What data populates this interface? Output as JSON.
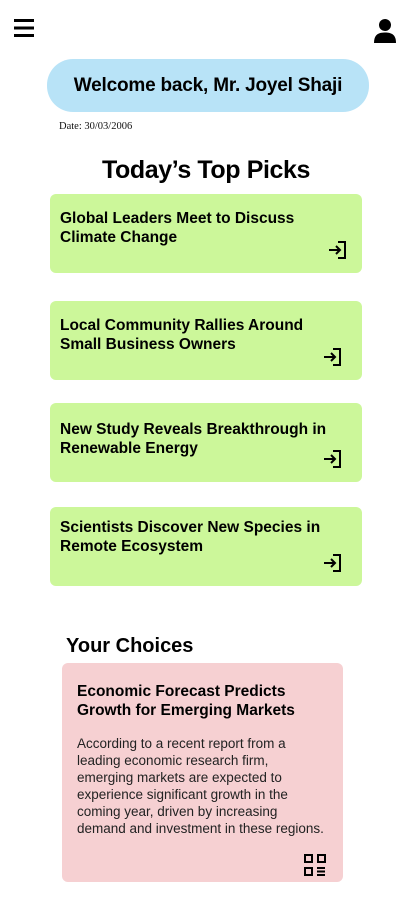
{
  "header": {
    "menu_icon": "hamburger-menu-icon",
    "profile_icon": "user-profile-icon",
    "welcome_text": "Welcome back, Mr. Joyel Shaji",
    "date_text": "Date: 30/03/2006"
  },
  "top_picks": {
    "title": "Today’s Top Picks",
    "items": [
      {
        "title": "Global Leaders Meet to Discuss Climate Change",
        "icon": "login-arrow-icon"
      },
      {
        "title": "Local Community Rallies Around Small Business Owners",
        "icon": "login-arrow-icon"
      },
      {
        "title": "New Study Reveals Breakthrough in Renewable Energy",
        "icon": "login-arrow-icon"
      },
      {
        "title": "Scientists Discover New Species in Remote Ecosystem",
        "icon": "login-arrow-icon"
      }
    ],
    "card_color": "#ccf79a"
  },
  "your_choices": {
    "title": "Your Choices",
    "card": {
      "title": "Economic Forecast Predicts Growth for Emerging Markets",
      "body": "According to a recent report from a leading economic research firm, emerging markets are expected to experience significant growth in the coming year, driven by increasing demand and investment in these regions.",
      "icon": "qr-code-icon"
    },
    "card_color": "#f6d0d2"
  },
  "colors": {
    "welcome_bg": "#b8e3f7"
  }
}
